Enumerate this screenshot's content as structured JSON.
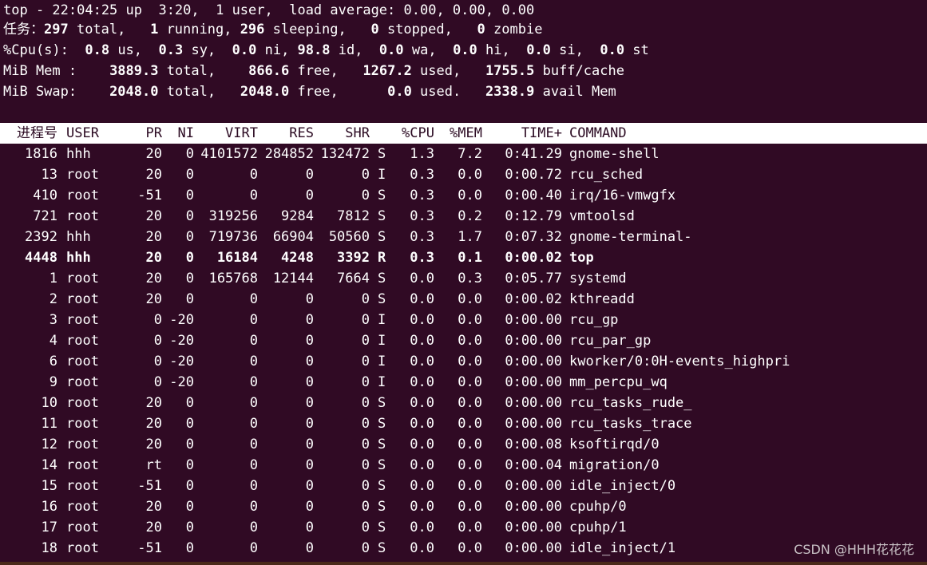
{
  "summary": {
    "line1": "top - 22:04:25 up  3:20,  1 user,  load average: 0.00, 0.00, 0.00",
    "tasks": {
      "label": "任务：",
      "total": "297",
      "total_label": " total,   ",
      "running": "1",
      "running_label": " running, ",
      "sleeping": "296",
      "sleeping_label": " sleeping,   ",
      "stopped": "0",
      "stopped_label": " stopped,   ",
      "zombie": "0",
      "zombie_label": " zombie"
    },
    "cpu": {
      "label": "%Cpu(s):  ",
      "us": "0.8",
      "us_label": " us,  ",
      "sy": "0.3",
      "sy_label": " sy,  ",
      "ni": "0.0",
      "ni_label": " ni, ",
      "id": "98.8",
      "id_label": " id,  ",
      "wa": "0.0",
      "wa_label": " wa,  ",
      "hi": "0.0",
      "hi_label": " hi,  ",
      "si": "0.0",
      "si_label": " si,  ",
      "st": "0.0",
      "st_label": " st"
    },
    "mem": {
      "label": "MiB Mem :    ",
      "total": "3889.3",
      "total_label": " total,    ",
      "free": "866.6",
      "free_label": " free,   ",
      "used": "1267.2",
      "used_label": " used,   ",
      "buff": "1755.5",
      "buff_label": " buff/cache"
    },
    "swap": {
      "label": "MiB Swap:    ",
      "total": "2048.0",
      "total_label": " total,   ",
      "free": "2048.0",
      "free_label": " free,      ",
      "used": "0.0",
      "used_label": " used.   ",
      "avail": "2338.9",
      "avail_label": " avail Mem"
    }
  },
  "columns": {
    "pid": "进程号",
    "user": "USER",
    "pr": "PR",
    "ni": "NI",
    "virt": "VIRT",
    "res": "RES",
    "shr": "SHR",
    "s": "",
    "cpu": "%CPU",
    "mem": "%MEM",
    "time": "TIME+",
    "command": "COMMAND"
  },
  "processes": [
    {
      "pid": "1816",
      "user": "hhh",
      "pr": "20",
      "ni": "0",
      "virt": "4101572",
      "res": "284852",
      "shr": "132472",
      "s": "S",
      "cpu": "1.3",
      "mem": "7.2",
      "time": "0:41.29",
      "command": "gnome-shell"
    },
    {
      "pid": "13",
      "user": "root",
      "pr": "20",
      "ni": "0",
      "virt": "0",
      "res": "0",
      "shr": "0",
      "s": "I",
      "cpu": "0.3",
      "mem": "0.0",
      "time": "0:00.72",
      "command": "rcu_sched"
    },
    {
      "pid": "410",
      "user": "root",
      "pr": "-51",
      "ni": "0",
      "virt": "0",
      "res": "0",
      "shr": "0",
      "s": "S",
      "cpu": "0.3",
      "mem": "0.0",
      "time": "0:00.40",
      "command": "irq/16-vmwgfx"
    },
    {
      "pid": "721",
      "user": "root",
      "pr": "20",
      "ni": "0",
      "virt": "319256",
      "res": "9284",
      "shr": "7812",
      "s": "S",
      "cpu": "0.3",
      "mem": "0.2",
      "time": "0:12.79",
      "command": "vmtoolsd"
    },
    {
      "pid": "2392",
      "user": "hhh",
      "pr": "20",
      "ni": "0",
      "virt": "719736",
      "res": "66904",
      "shr": "50560",
      "s": "S",
      "cpu": "0.3",
      "mem": "1.7",
      "time": "0:07.32",
      "command": "gnome-terminal-"
    },
    {
      "pid": "4448",
      "user": "hhh",
      "pr": "20",
      "ni": "0",
      "virt": "16184",
      "res": "4248",
      "shr": "3392",
      "s": "R",
      "cpu": "0.3",
      "mem": "0.1",
      "time": "0:00.02",
      "command": "top",
      "bold": true
    },
    {
      "pid": "1",
      "user": "root",
      "pr": "20",
      "ni": "0",
      "virt": "165768",
      "res": "12144",
      "shr": "7664",
      "s": "S",
      "cpu": "0.0",
      "mem": "0.3",
      "time": "0:05.77",
      "command": "systemd"
    },
    {
      "pid": "2",
      "user": "root",
      "pr": "20",
      "ni": "0",
      "virt": "0",
      "res": "0",
      "shr": "0",
      "s": "S",
      "cpu": "0.0",
      "mem": "0.0",
      "time": "0:00.02",
      "command": "kthreadd"
    },
    {
      "pid": "3",
      "user": "root",
      "pr": "0",
      "ni": "-20",
      "virt": "0",
      "res": "0",
      "shr": "0",
      "s": "I",
      "cpu": "0.0",
      "mem": "0.0",
      "time": "0:00.00",
      "command": "rcu_gp"
    },
    {
      "pid": "4",
      "user": "root",
      "pr": "0",
      "ni": "-20",
      "virt": "0",
      "res": "0",
      "shr": "0",
      "s": "I",
      "cpu": "0.0",
      "mem": "0.0",
      "time": "0:00.00",
      "command": "rcu_par_gp"
    },
    {
      "pid": "6",
      "user": "root",
      "pr": "0",
      "ni": "-20",
      "virt": "0",
      "res": "0",
      "shr": "0",
      "s": "I",
      "cpu": "0.0",
      "mem": "0.0",
      "time": "0:00.00",
      "command": "kworker/0:0H-events_highpri"
    },
    {
      "pid": "9",
      "user": "root",
      "pr": "0",
      "ni": "-20",
      "virt": "0",
      "res": "0",
      "shr": "0",
      "s": "I",
      "cpu": "0.0",
      "mem": "0.0",
      "time": "0:00.00",
      "command": "mm_percpu_wq"
    },
    {
      "pid": "10",
      "user": "root",
      "pr": "20",
      "ni": "0",
      "virt": "0",
      "res": "0",
      "shr": "0",
      "s": "S",
      "cpu": "0.0",
      "mem": "0.0",
      "time": "0:00.00",
      "command": "rcu_tasks_rude_"
    },
    {
      "pid": "11",
      "user": "root",
      "pr": "20",
      "ni": "0",
      "virt": "0",
      "res": "0",
      "shr": "0",
      "s": "S",
      "cpu": "0.0",
      "mem": "0.0",
      "time": "0:00.00",
      "command": "rcu_tasks_trace"
    },
    {
      "pid": "12",
      "user": "root",
      "pr": "20",
      "ni": "0",
      "virt": "0",
      "res": "0",
      "shr": "0",
      "s": "S",
      "cpu": "0.0",
      "mem": "0.0",
      "time": "0:00.08",
      "command": "ksoftirqd/0"
    },
    {
      "pid": "14",
      "user": "root",
      "pr": "rt",
      "ni": "0",
      "virt": "0",
      "res": "0",
      "shr": "0",
      "s": "S",
      "cpu": "0.0",
      "mem": "0.0",
      "time": "0:00.04",
      "command": "migration/0"
    },
    {
      "pid": "15",
      "user": "root",
      "pr": "-51",
      "ni": "0",
      "virt": "0",
      "res": "0",
      "shr": "0",
      "s": "S",
      "cpu": "0.0",
      "mem": "0.0",
      "time": "0:00.00",
      "command": "idle_inject/0"
    },
    {
      "pid": "16",
      "user": "root",
      "pr": "20",
      "ni": "0",
      "virt": "0",
      "res": "0",
      "shr": "0",
      "s": "S",
      "cpu": "0.0",
      "mem": "0.0",
      "time": "0:00.00",
      "command": "cpuhp/0"
    },
    {
      "pid": "17",
      "user": "root",
      "pr": "20",
      "ni": "0",
      "virt": "0",
      "res": "0",
      "shr": "0",
      "s": "S",
      "cpu": "0.0",
      "mem": "0.0",
      "time": "0:00.00",
      "command": "cpuhp/1"
    },
    {
      "pid": "18",
      "user": "root",
      "pr": "-51",
      "ni": "0",
      "virt": "0",
      "res": "0",
      "shr": "0",
      "s": "S",
      "cpu": "0.0",
      "mem": "0.0",
      "time": "0:00.00",
      "command": "idle_inject/1"
    }
  ],
  "watermark": "CSDN @HHH花花花",
  "colors": {
    "background": "#300a24",
    "foreground": "#ffffff",
    "header_bar_bg": "#ffffff",
    "header_bar_fg": "#2b0a22"
  }
}
